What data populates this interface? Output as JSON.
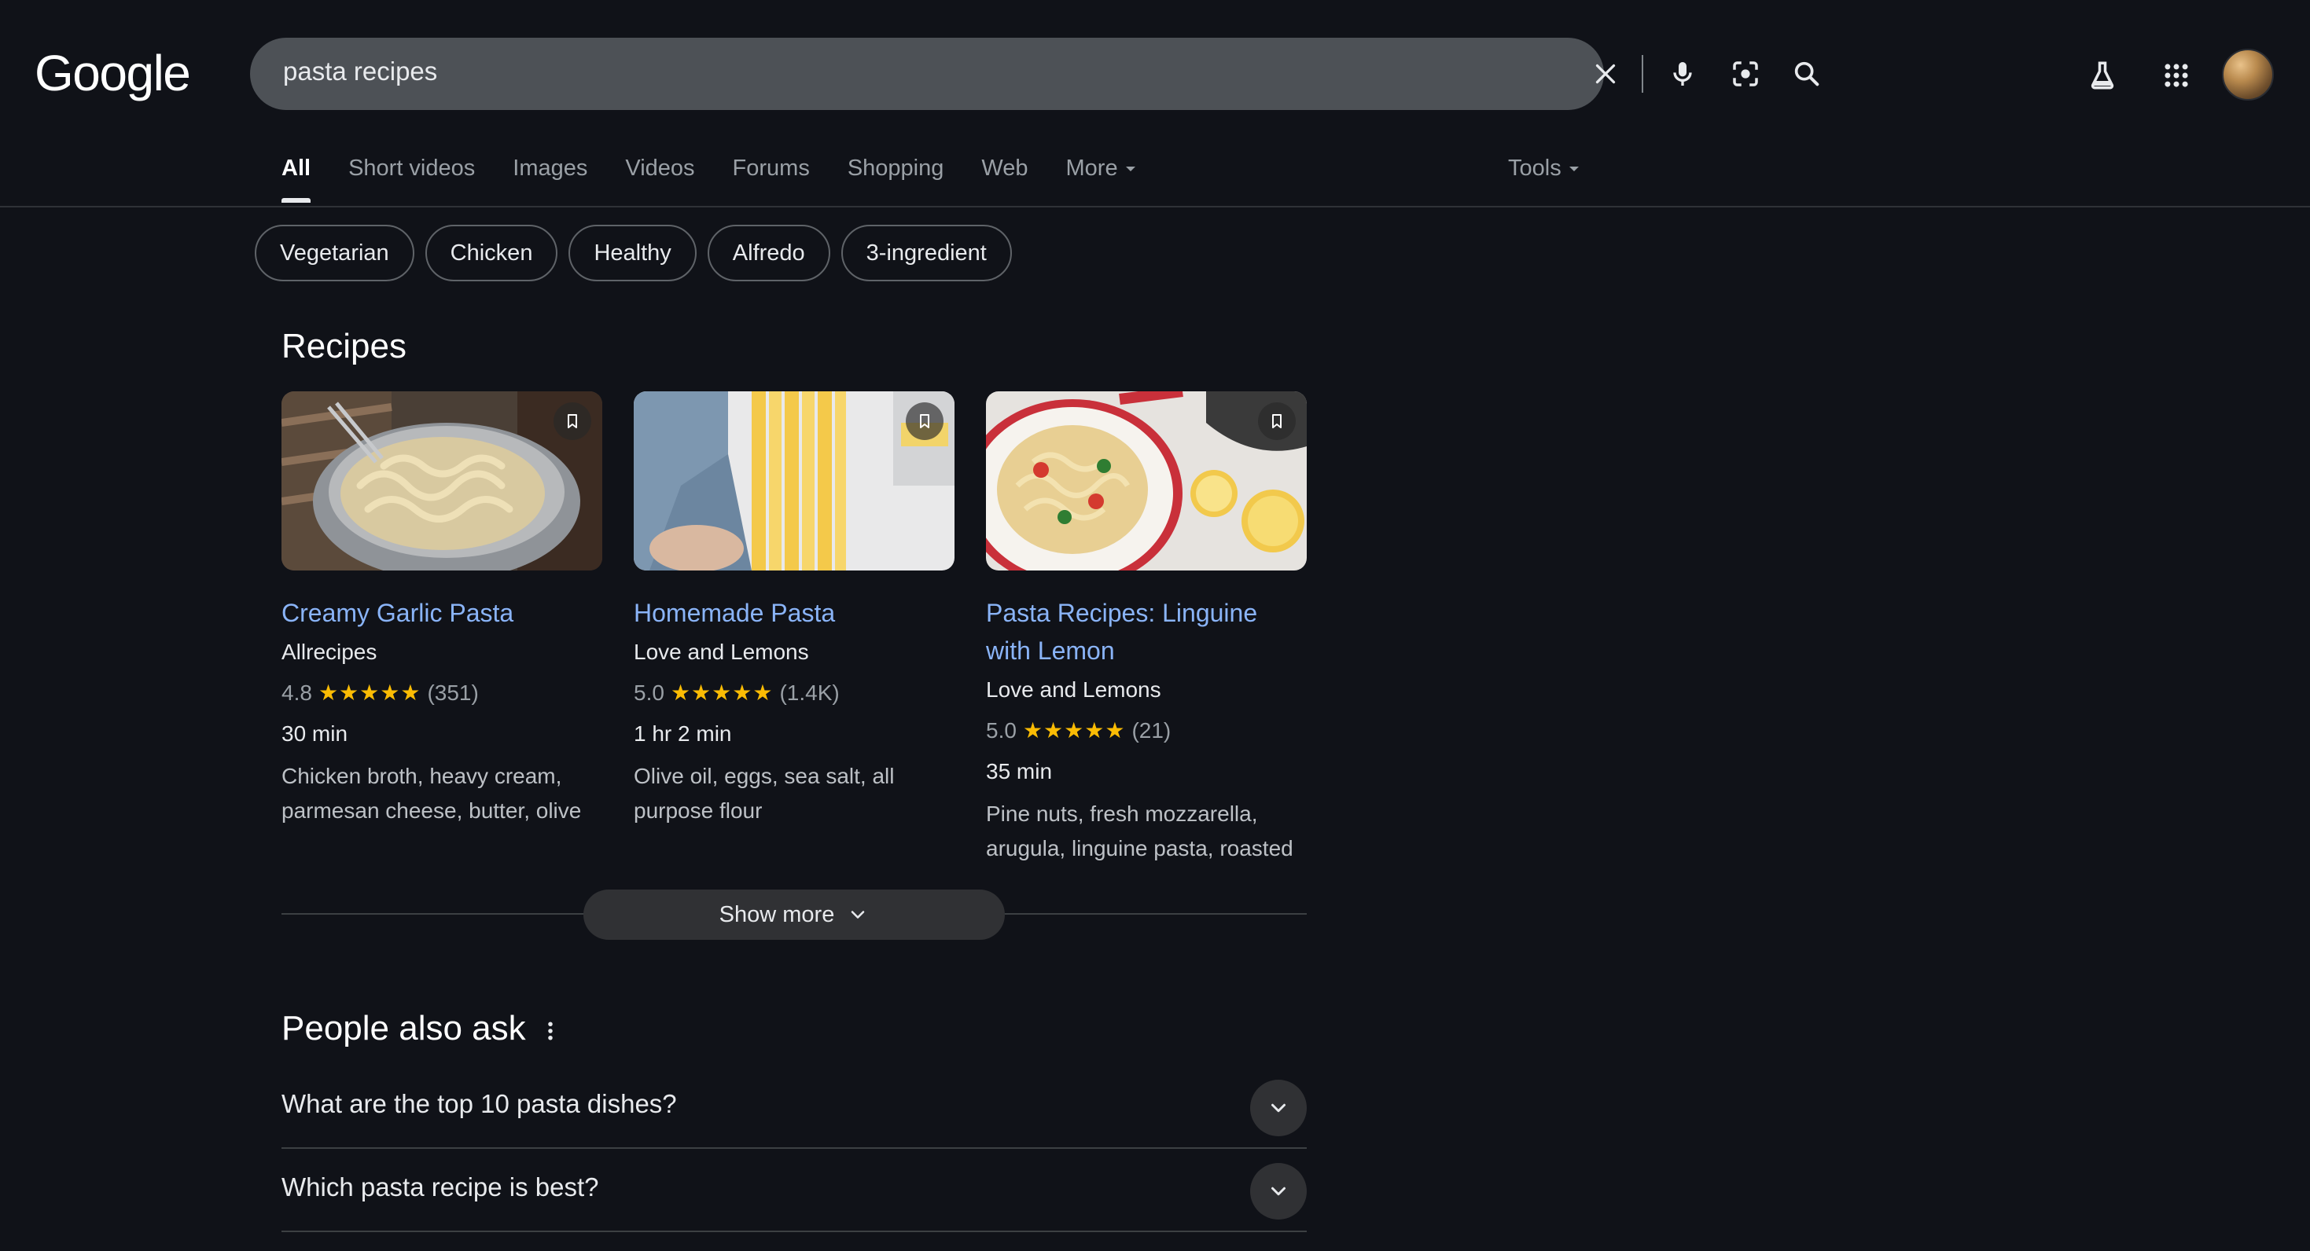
{
  "header": {
    "logo_text": "Google",
    "search_query": "pasta recipes",
    "icons": [
      "close-icon",
      "mic-icon",
      "lens-icon",
      "search-icon",
      "labs-icon",
      "apps-icon",
      "avatar"
    ]
  },
  "tabs": [
    {
      "label": "All",
      "active": true
    },
    {
      "label": "Short videos"
    },
    {
      "label": "Images"
    },
    {
      "label": "Videos"
    },
    {
      "label": "Forums"
    },
    {
      "label": "Shopping"
    },
    {
      "label": "Web"
    },
    {
      "label": "More"
    }
  ],
  "tools_label": "Tools",
  "chips": [
    "Vegetarian",
    "Chicken",
    "Healthy",
    "Alfredo",
    "3-ingredient"
  ],
  "recipes": {
    "title": "Recipes",
    "cards": [
      {
        "title": "Creamy Garlic Pasta",
        "source": "Allrecipes",
        "rating": "4.8",
        "reviews": "(351)",
        "time": "30 min",
        "ingredients": "Chicken broth, heavy cream, parmesan cheese, butter, olive"
      },
      {
        "title": "Homemade Pasta",
        "source": "Love and Lemons",
        "rating": "5.0",
        "reviews": "(1.4K)",
        "time": "1 hr 2 min",
        "ingredients": "Olive oil, eggs, sea salt, all purpose flour"
      },
      {
        "title": "Pasta Recipes: Linguine with Lemon",
        "source": "Love and Lemons",
        "rating": "5.0",
        "reviews": "(21)",
        "time": "35 min",
        "ingredients": "Pine nuts, fresh mozzarella, arugula, linguine pasta, roasted"
      }
    ],
    "show_more": "Show more"
  },
  "paa": {
    "title": "People also ask",
    "questions": [
      "What are the top 10 pasta dishes?",
      "Which pasta recipe is best?"
    ]
  },
  "colors": {
    "background": "#101218",
    "link": "#8ab4f8",
    "star": "#fbbc04",
    "searchbar": "#4d5156"
  }
}
